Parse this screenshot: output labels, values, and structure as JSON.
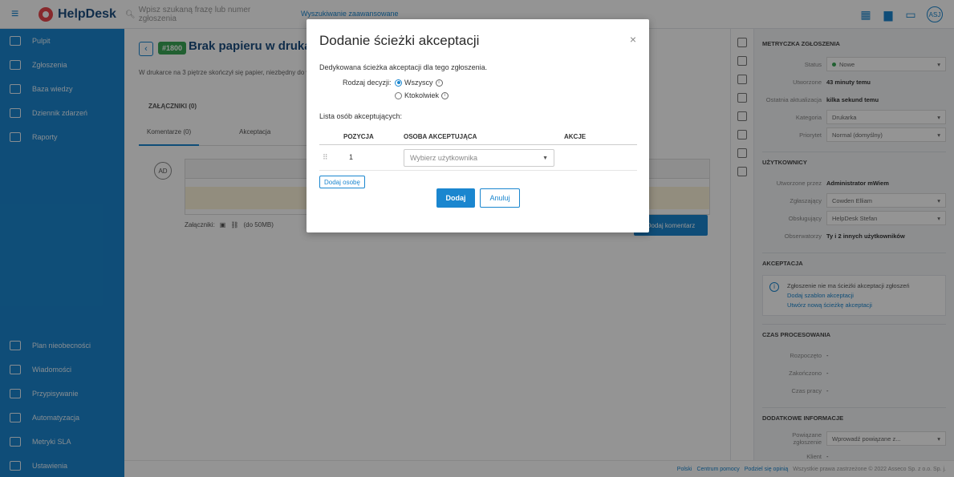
{
  "topbar": {
    "logo": "HelpDesk",
    "search_placeholder": "Wpisz szukaną frazę lub numer zgłoszenia",
    "advanced_search": "Wyszukiwanie zaawansowane",
    "avatar": "ASJ"
  },
  "sidebar": {
    "items": [
      {
        "label": "Pulpit",
        "icon": "dashboard-icon"
      },
      {
        "label": "Zgłoszenia",
        "icon": "tickets-icon"
      },
      {
        "label": "Baza wiedzy",
        "icon": "knowledge-icon"
      },
      {
        "label": "Dziennik zdarzeń",
        "icon": "log-icon"
      },
      {
        "label": "Raporty",
        "icon": "reports-icon"
      }
    ],
    "bottom_items": [
      {
        "label": "Plan nieobecności",
        "icon": "absence-icon"
      },
      {
        "label": "Wiadomości"
      },
      {
        "label": "Przypisywanie"
      },
      {
        "label": "Automatyzacja"
      },
      {
        "label": "Metryki SLA"
      },
      {
        "label": "Ustawienia"
      }
    ]
  },
  "ticket": {
    "id": "#1800",
    "title": "Brak papieru w drukarce",
    "description": "W drukarce na 3 piętrze skończył się papier, niezbędny do wydruku dokumentów.",
    "attachments_label": "ZAŁĄCZNIKI (0)",
    "tabs": [
      "Komentarze (0)",
      "Akceptacja"
    ],
    "editor_avatar": "AD",
    "attachments_row": "Załączniki:",
    "attachments_limit": "(do 50MB)",
    "add_comment": "Dodaj komentarz"
  },
  "right_panel": {
    "metrics_title": "METRYCZKA ZGŁOSZENIA",
    "status_label": "Status",
    "status_value": "Nowe",
    "created_label": "Utworzone",
    "created_value": "43 minuty temu",
    "updated_label": "Ostatnia aktualizacja",
    "updated_value": "kilka sekund temu",
    "category_label": "Kategoria",
    "category_value": "Drukarka",
    "priority_label": "Priorytet",
    "priority_value": "Normal (domyślny)",
    "users_title": "UŻYTKOWNICY",
    "created_by_label": "Utworzone przez",
    "created_by_value": "Administrator mWiem",
    "requester_label": "Zgłaszający",
    "requester_value": "Cowden Elliam",
    "handler_label": "Obsługujący",
    "handler_value": "HelpDesk Stefan",
    "observers_label": "Obserwatorzy",
    "observers_value": "Ty i 2 innych użytkowników",
    "acceptance_title": "AKCEPTACJA",
    "acceptance_info": "Zgłoszenie nie ma ścieżki akceptacji zgłoszeń",
    "acceptance_link1": "Dodaj szablon akceptacji",
    "acceptance_link2": "Utwórz nową ścieżkę akceptacji",
    "processing_title": "CZAS PROCESOWANIA",
    "response_label": "Rozpoczęto",
    "response_value": "-",
    "closed_label": "Zakończono",
    "closed_value": "-",
    "work_label": "Czas pracy",
    "work_value": "-",
    "extra_title": "DODATKOWE INFORMACJE",
    "related_label": "Powiązane zgłoszenie",
    "related_value": "Wprowadź powiązane z...",
    "client_label": "Klient",
    "client_value": "-"
  },
  "footer": {
    "lang": "Polski",
    "help": "Centrum pomocy",
    "feedback": "Podziel się opinią",
    "copyright": "Wszystkie prawa zastrzeżone © 2022 Asseco Sp. z o.o. Sp. j."
  },
  "modal": {
    "title": "Dodanie ścieżki akceptacji",
    "intro": "Dedykowana ścieżka akceptacji dla tego zgłoszenia.",
    "decision_label": "Rodzaj decyzji:",
    "option_all": "Wszyscy",
    "option_any": "Ktokolwiek",
    "list_label": "Lista osób akceptujących:",
    "col_position": "POZYCJA",
    "col_person": "OSOBA AKCEPTUJĄCA",
    "col_actions": "AKCJE",
    "row_position": "1",
    "select_placeholder": "Wybierz użytkownika",
    "add_person": "Dodaj osobę",
    "add": "Dodaj",
    "cancel": "Anuluj"
  }
}
